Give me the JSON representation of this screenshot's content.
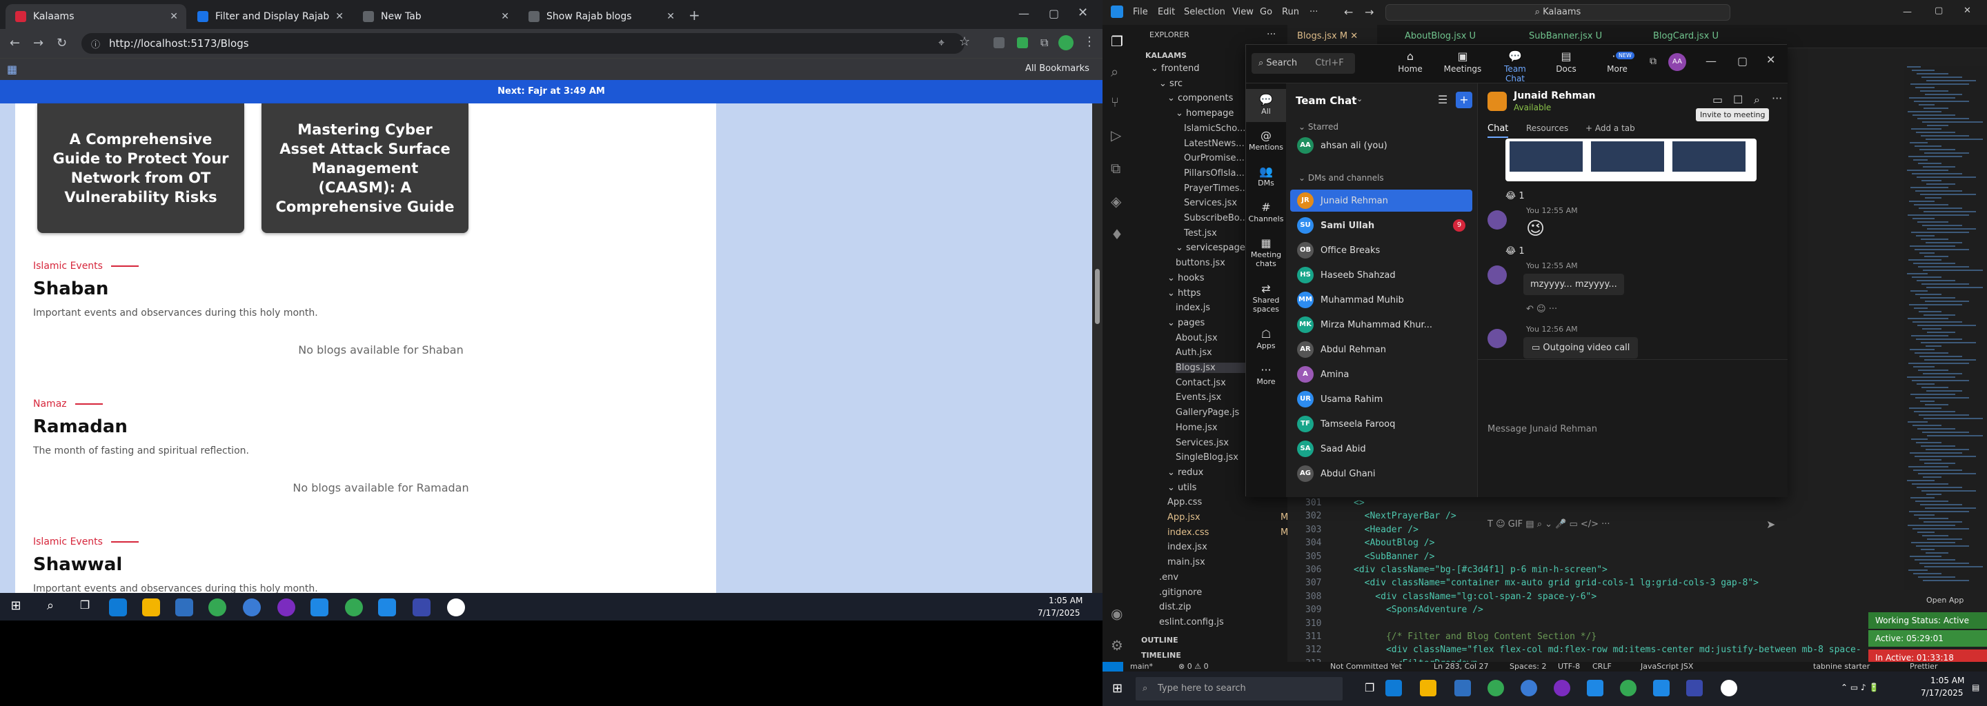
{
  "browser": {
    "tabs": [
      {
        "label": "Kalaams",
        "active": true
      },
      {
        "label": "Filter and Display Rajab Blog In",
        "active": false
      },
      {
        "label": "New Tab",
        "active": false
      },
      {
        "label": "Show Rajab blogs",
        "active": false
      }
    ],
    "url": "http://localhost:5173/Blogs",
    "all_bookmarks": "All Bookmarks",
    "prayer_bar": "Next: Fajr at 3:49 AM"
  },
  "page": {
    "cards": [
      {
        "title": "A Comprehensive Guide to Protect Your Network from OT Vulnerability Risks"
      },
      {
        "title": "Mastering Cyber Asset Attack Surface Management (CAASM): A Comprehensive Guide"
      }
    ],
    "sections": [
      {
        "category": "Islamic Events",
        "title": "Shaban",
        "description": "Important events and observances during this holy month.",
        "empty": "No blogs available for Shaban"
      },
      {
        "category": "Namaz",
        "title": "Ramadan",
        "description": "The month of fasting and spiritual reflection.",
        "empty": "No blogs available for Ramadan"
      },
      {
        "category": "Islamic Events",
        "title": "Shawwal",
        "description": "Important events and observances during this holy month."
      }
    ]
  },
  "taskbar_left": {
    "time": "1:05 AM",
    "date": "7/17/2025"
  },
  "vscode": {
    "menu": [
      "File",
      "Edit",
      "Selection",
      "View",
      "Go",
      "Run",
      "···"
    ],
    "search": "Kalaams",
    "tabs": [
      {
        "label": "Blogs.jsx",
        "status": "M"
      },
      {
        "label": "AboutBlog.jsx",
        "status": "U"
      },
      {
        "label": "SubBanner.jsx",
        "status": "U"
      },
      {
        "label": "BlogCard.jsx",
        "status": "U"
      }
    ],
    "explorer_title": "EXPLORER",
    "root": "KALAAMS",
    "tree": [
      {
        "label": "frontend",
        "badge": ""
      },
      {
        "label": "src",
        "badge": ""
      },
      {
        "label": "components",
        "badge": ""
      },
      {
        "label": "homepage",
        "badge": ""
      },
      {
        "label": "IslamicScho...",
        "badge": ""
      },
      {
        "label": "LatestNews...",
        "badge": ""
      },
      {
        "label": "OurPromise...",
        "badge": ""
      },
      {
        "label": "PillarsOfIsla...",
        "badge": ""
      },
      {
        "label": "PrayerTimes...",
        "badge": ""
      },
      {
        "label": "Services.jsx",
        "badge": ""
      },
      {
        "label": "SubscribeBo...",
        "badge": ""
      },
      {
        "label": "Test.jsx",
        "badge": ""
      },
      {
        "label": "servicespage",
        "badge": ""
      },
      {
        "label": "buttons.jsx",
        "badge": ""
      },
      {
        "label": "hooks",
        "badge": ""
      },
      {
        "label": "https",
        "badge": ""
      },
      {
        "label": "index.js",
        "badge": ""
      },
      {
        "label": "pages",
        "badge": ""
      },
      {
        "label": "About.jsx",
        "badge": ""
      },
      {
        "label": "Auth.jsx",
        "badge": ""
      },
      {
        "label": "Blogs.jsx",
        "badge": ""
      },
      {
        "label": "Contact.jsx",
        "badge": ""
      },
      {
        "label": "Events.jsx",
        "badge": ""
      },
      {
        "label": "GalleryPage.js",
        "badge": ""
      },
      {
        "label": "Home.jsx",
        "badge": ""
      },
      {
        "label": "Services.jsx",
        "badge": ""
      },
      {
        "label": "SingleBlog.jsx",
        "badge": ""
      },
      {
        "label": "redux",
        "badge": ""
      },
      {
        "label": "utils",
        "badge": ""
      },
      {
        "label": "App.css",
        "badge": ""
      },
      {
        "label": "App.jsx",
        "badge": "M"
      },
      {
        "label": "index.css",
        "badge": "M"
      },
      {
        "label": "index.jsx",
        "badge": ""
      },
      {
        "label": "main.jsx",
        "badge": ""
      },
      {
        "label": ".env",
        "badge": ""
      },
      {
        "label": ".gitignore",
        "badge": ""
      },
      {
        "label": "dist.zip",
        "badge": ""
      },
      {
        "label": "eslint.config.js",
        "badge": ""
      }
    ],
    "outline": "OUTLINE",
    "timeline": "TIMELINE",
    "code_lines": [
      {
        "n": "301",
        "text": "<>"
      },
      {
        "n": "302",
        "text": "  <NextPrayerBar />"
      },
      {
        "n": "303",
        "text": "  <Header />"
      },
      {
        "n": "304",
        "text": "  <AboutBlog />"
      },
      {
        "n": "305",
        "text": "  <SubBanner />"
      },
      {
        "n": "306",
        "text": "<div className=\"bg-[#c3d4f1] p-6 min-h-screen\">"
      },
      {
        "n": "307",
        "text": "  <div className=\"container mx-auto grid grid-cols-1 lg:grid-cols-3 gap-8\">"
      },
      {
        "n": "308",
        "text": "    <div className=\"lg:col-span-2 space-y-6\">"
      },
      {
        "n": "309",
        "text": "      <SponsAdventure />"
      },
      {
        "n": "310",
        "text": ""
      },
      {
        "n": "311",
        "text": "      {/* Filter and Blog Content Section */}"
      },
      {
        "n": "312",
        "text": "      <div className=\"flex flex-col md:flex-row md:items-center md:justify-between mb-8 space-"
      },
      {
        "n": "313",
        "text": "        <FilterDropdown"
      }
    ],
    "status": {
      "branch": "main*",
      "errors": "⊗ 0 ⚠ 0",
      "not_committed": "Not Committed Yet",
      "position": "Ln 283, Col 27",
      "spaces": "Spaces: 2",
      "encoding": "UTF-8",
      "eol": "CRLF",
      "language": "JavaScript JSX",
      "prettier": "Prettier",
      "tabnine": "tabnine starter"
    },
    "working_status": [
      {
        "label": "Working Status: Active",
        "color": "#2e7d32"
      },
      {
        "label": "Active: 05:29:01",
        "color": "#388e3c"
      },
      {
        "label": "In Active: 01:33:18",
        "color": "#d32f2f"
      }
    ],
    "open_app": "Open App"
  },
  "teams": {
    "search": "Search",
    "search_shortcut": "Ctrl+F",
    "nav": [
      {
        "label": "Home",
        "icon": "home-icon"
      },
      {
        "label": "Meetings",
        "icon": "camera-icon"
      },
      {
        "label": "Team Chat",
        "icon": "chat-icon"
      },
      {
        "label": "Docs",
        "icon": "doc-icon"
      },
      {
        "label": "More",
        "icon": "more-icon"
      }
    ],
    "new_badge": "NEW",
    "profile": "AA",
    "rail": [
      {
        "label": "All"
      },
      {
        "label": "Mentions"
      },
      {
        "label": "DMs"
      },
      {
        "label": "Channels"
      },
      {
        "label": "Meeting chats"
      },
      {
        "label": "Shared spaces"
      },
      {
        "label": "Apps"
      },
      {
        "label": "More"
      }
    ],
    "list_title": "Team Chat",
    "starred": "Starred",
    "starred_items": [
      {
        "name": "ahsan ali (you)",
        "initials": "AA",
        "color": "#1e8f5f"
      }
    ],
    "dms_header": "DMs and channels",
    "people": [
      {
        "name": "Junaid Rehman",
        "initials": "JR",
        "color": "#e48b1a",
        "selected": true,
        "badge": ""
      },
      {
        "name": "Sami Ullah",
        "initials": "SU",
        "color": "#2d8cf0",
        "selected": false,
        "badge": "9"
      },
      {
        "name": "Office Breaks",
        "initials": "OB",
        "color": "#555",
        "selected": false,
        "badge": ""
      },
      {
        "name": "Haseeb Shahzad",
        "initials": "HS",
        "color": "#18a58a",
        "selected": false,
        "badge": ""
      },
      {
        "name": "Muhammad Muhib",
        "initials": "MM",
        "color": "#2d8cf0",
        "selected": false,
        "badge": ""
      },
      {
        "name": "Mirza Muhammad Khur...",
        "initials": "MK",
        "color": "#18a58a",
        "selected": false,
        "badge": ""
      },
      {
        "name": "Abdul Rehman",
        "initials": "AR",
        "color": "#555",
        "selected": false,
        "badge": ""
      },
      {
        "name": "Amina",
        "initials": "A",
        "color": "#9b59b6",
        "selected": false,
        "badge": ""
      },
      {
        "name": "Usama Rahim",
        "initials": "UR",
        "color": "#2d8cf0",
        "selected": false,
        "badge": ""
      },
      {
        "name": "Tamseela Farooq",
        "initials": "TF",
        "color": "#18a58a",
        "selected": false,
        "badge": ""
      },
      {
        "name": "Saad Abid",
        "initials": "SA",
        "color": "#18a58a",
        "selected": false,
        "badge": ""
      },
      {
        "name": "Abdul Ghani",
        "initials": "AG",
        "color": "#555",
        "selected": false,
        "badge": ""
      }
    ],
    "chat_header": {
      "name": "Junaid Rehman",
      "status": "Available"
    },
    "chat_tabs": [
      "Chat",
      "Resources",
      "+ Add a tab"
    ],
    "tooltip": "Invite to meeting",
    "messages": [
      {
        "time": "You 12:55 AM",
        "text": "😉"
      },
      {
        "time": "You 12:55 AM",
        "text": "mzyyyy... mzyyyy..."
      },
      {
        "time": "You 12:56 AM",
        "text": "Outgoing video call"
      }
    ],
    "reaction": "😂 1",
    "compose_placeholder": "Message Junaid Rehman"
  },
  "taskbar_right": {
    "search": "Type here to search",
    "time": "1:05 AM",
    "date": "7/17/2025"
  }
}
